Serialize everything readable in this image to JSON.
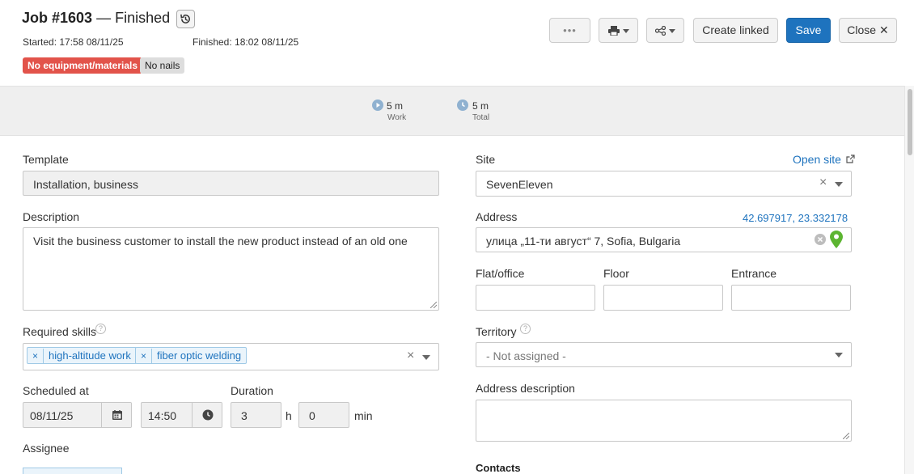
{
  "header": {
    "job_number": "Job #1603",
    "status": "— Finished",
    "started": "Started: 17:58 08/11/25",
    "finished": "Finished: 18:02 08/11/25",
    "tags": [
      "No equipment/materials",
      "No nails"
    ]
  },
  "toolbar": {
    "more_label": "•••",
    "create_linked": "Create linked",
    "save": "Save",
    "close": "Close ✕"
  },
  "stats": {
    "work_value": "5 m",
    "work_label": "Work",
    "total_value": "5 m",
    "total_label": "Total"
  },
  "form": {
    "template_label": "Template",
    "template_value": "Installation, business",
    "description_label": "Description",
    "description_value": "Visit the business customer to install the new product instead of an old one",
    "skills_label": "Required skills",
    "skills": [
      "high-altitude work",
      "fiber optic welding"
    ],
    "scheduled_label": "Scheduled at",
    "scheduled_date": "08/11/25",
    "scheduled_time": "14:50",
    "duration_label": "Duration",
    "duration_hours": "3",
    "hours_unit": "h",
    "duration_minutes": "0",
    "minutes_unit": "min",
    "assignee_label": "Assignee",
    "site_label": "Site",
    "open_site": "Open site",
    "site_value": "SevenEleven",
    "address_label": "Address",
    "coordinates": "42.697917, 23.332178",
    "address_value": "улица „11-ти август“ 7, Sofia, Bulgaria",
    "flat_label": "Flat/office",
    "floor_label": "Floor",
    "entrance_label": "Entrance",
    "territory_label": "Territory",
    "territory_value": "- Not assigned -",
    "address_desc_label": "Address description",
    "contacts_label": "Contacts"
  },
  "colors": {
    "accent": "#1e73be",
    "tag_red": "#e2534a",
    "pin_green": "#5cb531"
  }
}
